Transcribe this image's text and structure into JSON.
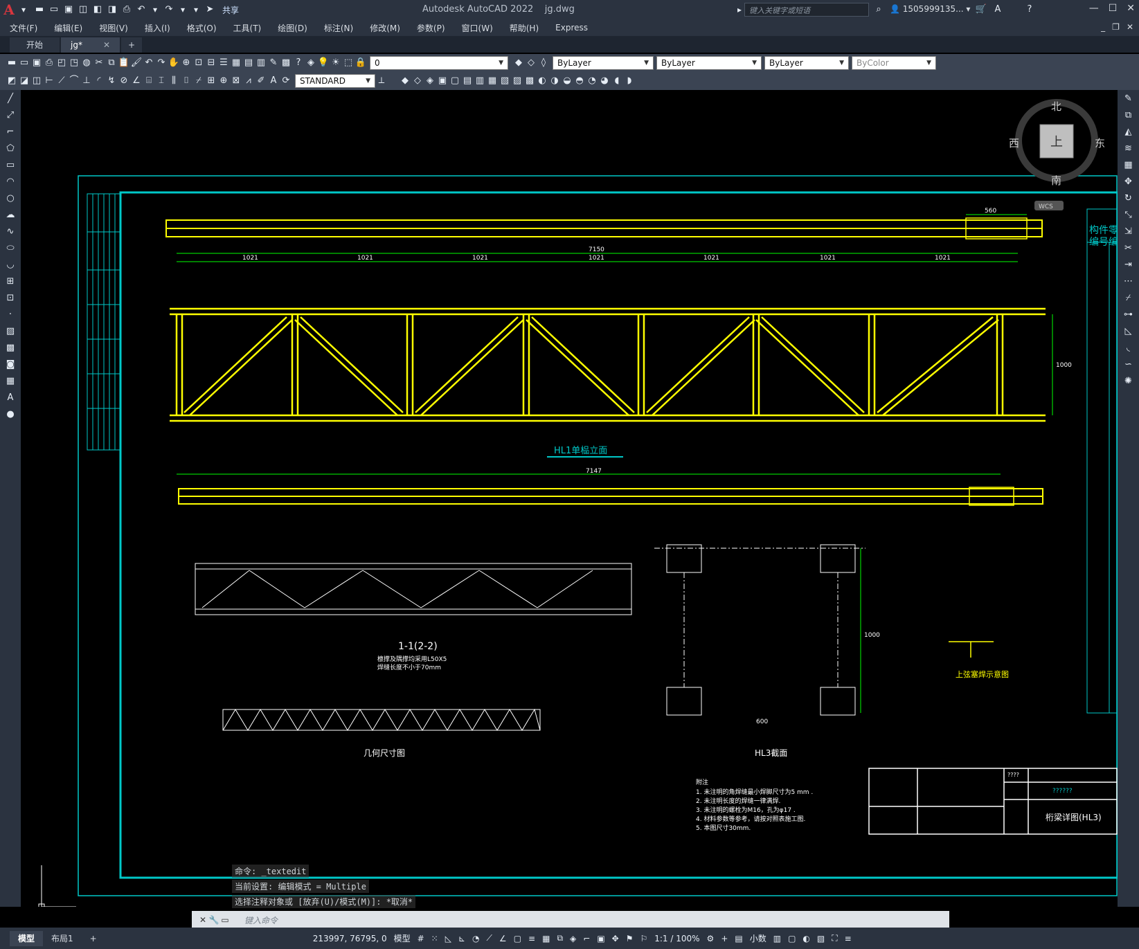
{
  "window": {
    "app_title": "Autodesk AutoCAD 2022",
    "file_name": "jg.dwg",
    "search_placeholder": "键入关键字或短语",
    "user": "1505999135...",
    "share": "共享"
  },
  "menu": [
    "文件(F)",
    "编辑(E)",
    "视图(V)",
    "插入(I)",
    "格式(O)",
    "工具(T)",
    "绘图(D)",
    "标注(N)",
    "修改(M)",
    "参数(P)",
    "窗口(W)",
    "帮助(H)",
    "Express"
  ],
  "tabs": [
    {
      "label": "开始"
    },
    {
      "label": "jg*"
    }
  ],
  "toolbar": {
    "layer_value": "0",
    "color": "ByLayer",
    "linetype": "ByLayer",
    "lineweight": "ByLayer",
    "plotstyle": "ByColor",
    "text_style": "STANDARD"
  },
  "viewcube": {
    "north": "北",
    "south": "南",
    "east": "东",
    "west": "西",
    "face": "上",
    "wcs": "WCS"
  },
  "drawing": {
    "top_chord_dim": "560",
    "total_top": "7150",
    "total_bottom": "7147",
    "span": "1021",
    "elev_title": "HL1单榀立面",
    "section_title": "1-1(2-2)",
    "section_note1": "檩撑及隅撑均采用L50X5",
    "section_note2": "焊缝长度不小于70mm",
    "geo_title": "几何尺寸图",
    "hl3_title": "HL3截面",
    "weld_title": "上弦塞焊示意图",
    "height_1000": "1000",
    "d600": "600",
    "notes_title": "附注",
    "notes": [
      "1. 未注明的角焊缝最小焊脚尺寸为5 mm .",
      "2. 未注明长度的焊缝一律满焊.",
      "3. 未注明的螺栓为M16，孔为φ17 .",
      "4. 材料参数等参考，请按对照表施工图.",
      "5. 本图尺寸30mm."
    ],
    "tb_project": "????",
    "tb_title": "桁梁详图(HL3)",
    "tb_q": "??????"
  },
  "command": {
    "line1": "命令: _textedit",
    "line2": "当前设置: 编辑模式 = Multiple",
    "line3": "选择注释对象或 [放弃(U)/模式(M)]: *取消*",
    "placeholder": "键入命令"
  },
  "status": {
    "layout_tabs": [
      "模型",
      "布局1"
    ],
    "coords": "213997, 76795, 0",
    "model": "模型",
    "scale": "1:1 / 100%",
    "units": "小数"
  },
  "colors": {
    "accent": "#00c8c8",
    "chord": "#ffff00",
    "dim": "#00ff00",
    "ui_bg": "#2b3340"
  }
}
